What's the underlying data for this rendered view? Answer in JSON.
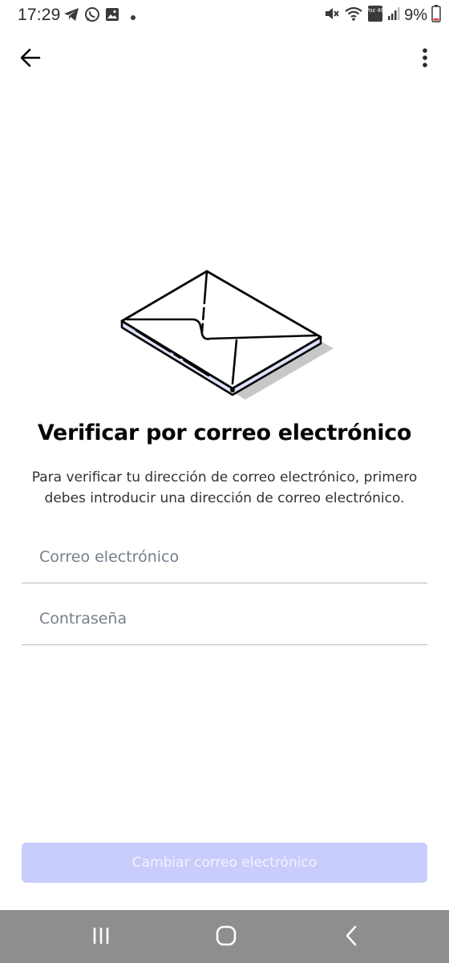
{
  "status_bar": {
    "time": "17:29",
    "battery_percent": "9%",
    "left_icons": [
      "telegram-icon",
      "whatsapp-icon",
      "gallery-icon",
      "dot-icon"
    ],
    "right_icons": [
      "mute-icon",
      "wifi-icon",
      "volte-4g-icon",
      "signal-icon",
      "battery-icon"
    ],
    "signal_network_label": "Voz 4G"
  },
  "top_bar": {
    "back_icon": "arrow-left-icon",
    "menu_icon": "more-vertical-icon"
  },
  "illustration": {
    "icon": "envelope-illustration",
    "accent_color": "#dfe3f7"
  },
  "content": {
    "title": "Verificar por correo electrónico",
    "subtitle": "Para verificar tu dirección de correo electrónico, primero debes introducir una dirección de correo electrónico."
  },
  "form": {
    "email": {
      "value": "",
      "placeholder": "Correo electrónico"
    },
    "password": {
      "value": "",
      "placeholder": "Contraseña"
    }
  },
  "submit": {
    "label": "Cambiar correo electrónico",
    "enabled": false,
    "color": "#c9cdfb"
  },
  "nav_bar": {
    "recents_icon": "recents-icon",
    "home_icon": "home-icon",
    "back_icon": "back-chevron-icon"
  }
}
